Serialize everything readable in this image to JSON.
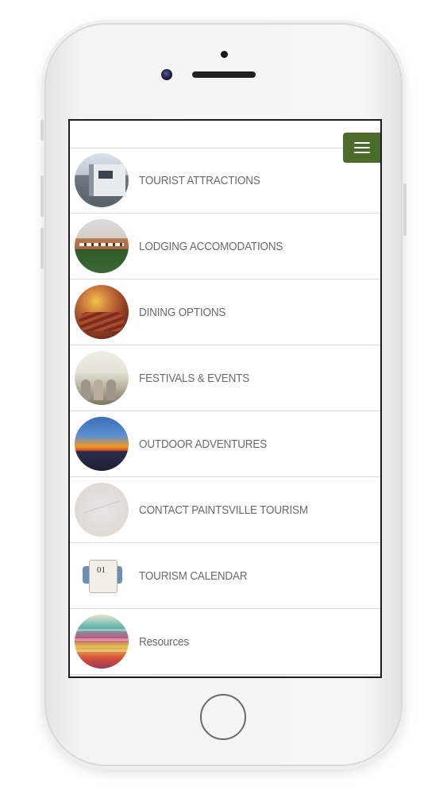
{
  "app": {
    "accent_color": "#4a6b2a",
    "menu_icon": "hamburger-menu-icon"
  },
  "menu": {
    "items": [
      {
        "label": "TOURIST ATTRACTIONS",
        "image": "building-photo"
      },
      {
        "label": "LODGING ACCOMODATIONS",
        "image": "hotel-photo"
      },
      {
        "label": "DINING OPTIONS",
        "image": "steak-dinner-photo"
      },
      {
        "label": "FESTIVALS & EVENTS",
        "image": "festival-crowd-photo"
      },
      {
        "label": "OUTDOOR ADVENTURES",
        "image": "lake-sunset-photo"
      },
      {
        "label": "CONTACT PAINTSVILLE TOURISM",
        "image": "map-photo"
      },
      {
        "label": "TOURISM CALENDAR",
        "image": "calendar-photo"
      },
      {
        "label": "Resources",
        "image": "colored-paper-photo"
      }
    ]
  }
}
